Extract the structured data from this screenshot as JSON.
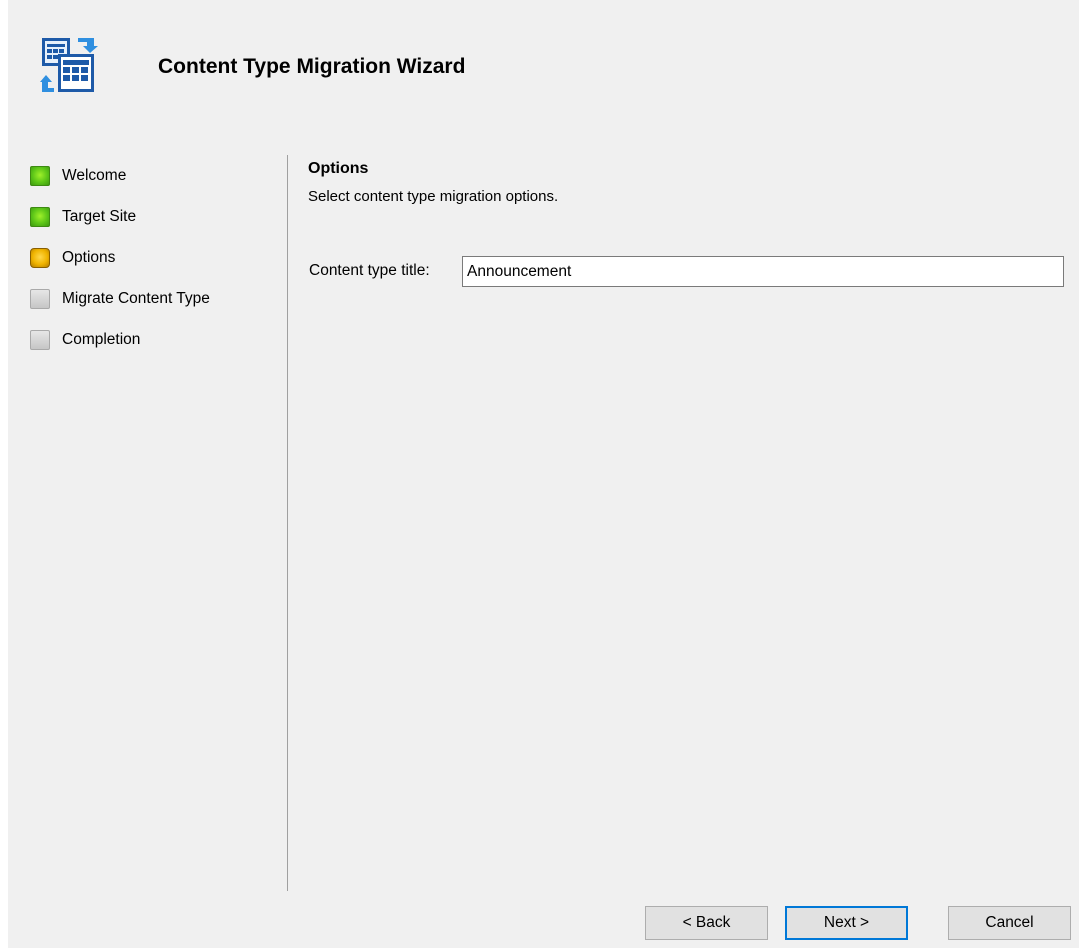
{
  "header": {
    "title": "Content Type Migration Wizard",
    "icon": "content-type-migration-icon"
  },
  "steps": [
    {
      "label": "Welcome",
      "state": "done"
    },
    {
      "label": "Target Site",
      "state": "done"
    },
    {
      "label": "Options",
      "state": "current"
    },
    {
      "label": "Migrate Content Type",
      "state": "pending"
    },
    {
      "label": "Completion",
      "state": "pending"
    }
  ],
  "content": {
    "section_title": "Options",
    "section_desc": "Select content type migration options.",
    "field_label": "Content type title:",
    "field_value": "Announcement"
  },
  "buttons": {
    "back": "< Back",
    "next": "Next >",
    "cancel": "Cancel"
  },
  "colors": {
    "done": "#5dc618",
    "current": "#f0b400",
    "pending": "#c6c6c6",
    "accent": "#0078d7",
    "window_bg": "#f0f0f0"
  }
}
